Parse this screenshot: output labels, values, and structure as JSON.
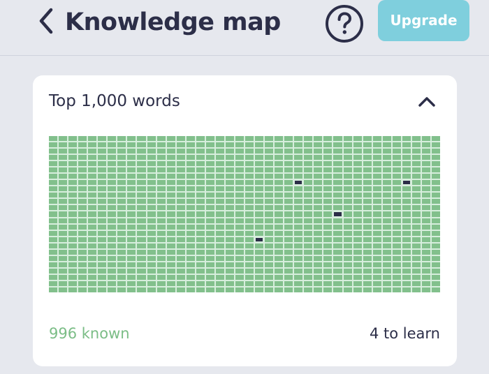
{
  "header": {
    "title": "Knowledge map",
    "back_icon": "chevron-left-icon",
    "help_icon": "question-circle-icon",
    "upgrade_label": "Upgrade"
  },
  "card": {
    "title": "Top 1,000 words",
    "collapse_icon": "chevron-up-icon",
    "known_label": "996 known",
    "learn_label": "4 to learn"
  },
  "word_grid": {
    "columns": 40,
    "rows": 25,
    "total_words": 1000,
    "known_count": 996,
    "unknown_cells": [
      [
        7,
        25
      ],
      [
        7,
        36
      ],
      [
        12,
        29
      ],
      [
        16,
        21
      ]
    ],
    "colors": {
      "known": "#82c08c",
      "unknown": "#2c2e48",
      "grid_lines": "#d7eedd"
    }
  },
  "colors": {
    "background": "#e6e8ee",
    "text": "#2c2e48",
    "accent": "#7fcfdd",
    "known_text": "#7bbd86",
    "card": "#ffffff"
  }
}
